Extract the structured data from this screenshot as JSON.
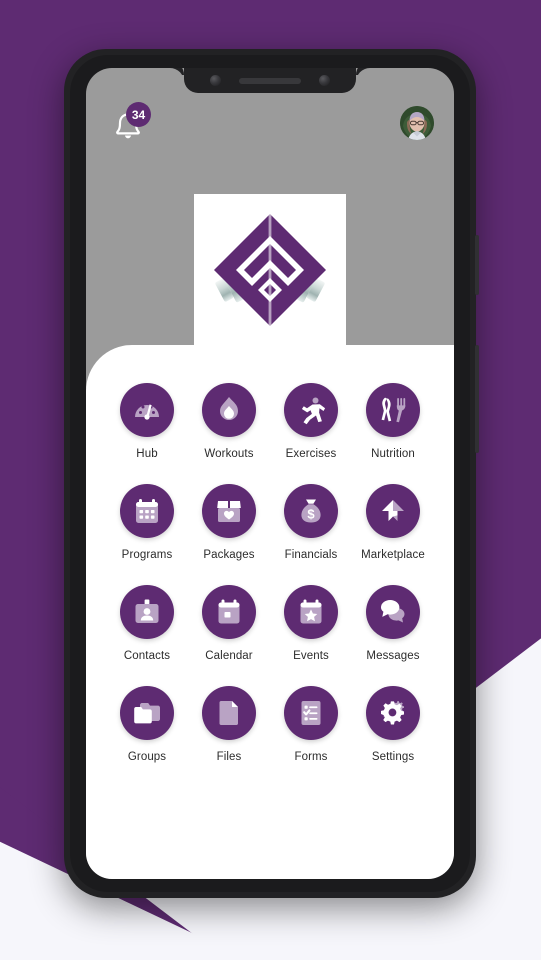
{
  "theme": {
    "brand_purple": "#5e2b72",
    "icon_light": "#b9a3c4",
    "icon_white": "#ffffff",
    "screen_bg": "#9b9b9b",
    "panel_bg": "#ffffff",
    "page_bg": "#f6f6fb"
  },
  "status": {
    "notification_icon": "bell-icon",
    "notification_count": "34",
    "avatar_icon": "user-avatar"
  },
  "branding": {
    "logo_icon": "diamond-barbell-logo",
    "logo_alt": "Fitness app diamond logo with barbells"
  },
  "app_grid": {
    "columns": 4,
    "items": [
      {
        "label": "Hub",
        "icon": "gauge-icon"
      },
      {
        "label": "Workouts",
        "icon": "flame-icon"
      },
      {
        "label": "Exercises",
        "icon": "running-person-icon"
      },
      {
        "label": "Nutrition",
        "icon": "fork-knife-icon"
      },
      {
        "label": "Programs",
        "icon": "calendar-grid-icon"
      },
      {
        "label": "Packages",
        "icon": "box-heart-icon"
      },
      {
        "label": "Financials",
        "icon": "money-bag-icon"
      },
      {
        "label": "Marketplace",
        "icon": "arrow-flag-icon"
      },
      {
        "label": "Contacts",
        "icon": "id-badge-icon"
      },
      {
        "label": "Calendar",
        "icon": "calendar-icon"
      },
      {
        "label": "Events",
        "icon": "calendar-star-icon"
      },
      {
        "label": "Messages",
        "icon": "chat-bubbles-icon"
      },
      {
        "label": "Groups",
        "icon": "folders-icon"
      },
      {
        "label": "Files",
        "icon": "document-icon"
      },
      {
        "label": "Forms",
        "icon": "checklist-icon"
      },
      {
        "label": "Settings",
        "icon": "gears-icon"
      }
    ]
  },
  "device": {
    "front_camera_icon": "camera-dot",
    "earpiece_icon": "earpiece-speaker",
    "bottom_speaker_icon": "bottom-speaker-grille",
    "power_button": "power-button",
    "volume_button": "volume-button"
  }
}
